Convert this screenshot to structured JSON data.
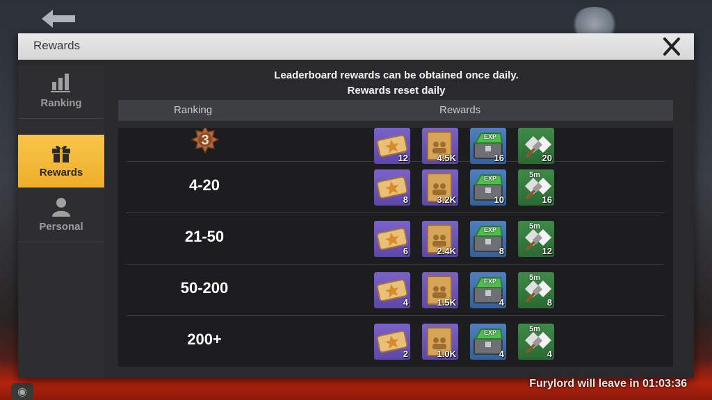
{
  "panel": {
    "title": "Rewards"
  },
  "sidebar": {
    "tabs": [
      {
        "label": "Ranking",
        "icon": "bar-chart-icon",
        "active": false
      },
      {
        "label": "Rewards",
        "icon": "gift-icon",
        "active": true
      },
      {
        "label": "Personal",
        "icon": "person-icon",
        "active": false
      }
    ]
  },
  "notice": {
    "line1": "Leaderboard rewards can be obtained once daily.",
    "line2": "Rewards reset daily"
  },
  "table": {
    "headers": {
      "ranking": "Ranking",
      "rewards": "Rewards"
    },
    "rows": [
      {
        "rank": "3",
        "rewards": [
          "12",
          "4.5K",
          "16",
          "20"
        ]
      },
      {
        "rank": "4-20",
        "rewards": [
          "8",
          "3.2K",
          "10",
          "16"
        ]
      },
      {
        "rank": "21-50",
        "rewards": [
          "6",
          "2.4K",
          "8",
          "12"
        ]
      },
      {
        "rank": "50-200",
        "rewards": [
          "4",
          "1.5K",
          "4",
          "8"
        ]
      },
      {
        "rank": "200+",
        "rewards": [
          "2",
          "1.0K",
          "4",
          "4"
        ]
      }
    ],
    "reward_icons": [
      "gold-ticket-icon",
      "recruit-envelope-icon",
      "exp-chest-icon",
      "speedup-hammer-icon"
    ],
    "item_badges": {
      "exp": "EXP",
      "speedup": "5m"
    }
  },
  "footer": {
    "text": "Furylord will leave in 01:03:36"
  },
  "colors": {
    "accent": "#f0ad2a",
    "panel": "#2a2a2d",
    "header": "#e0e0e0"
  }
}
